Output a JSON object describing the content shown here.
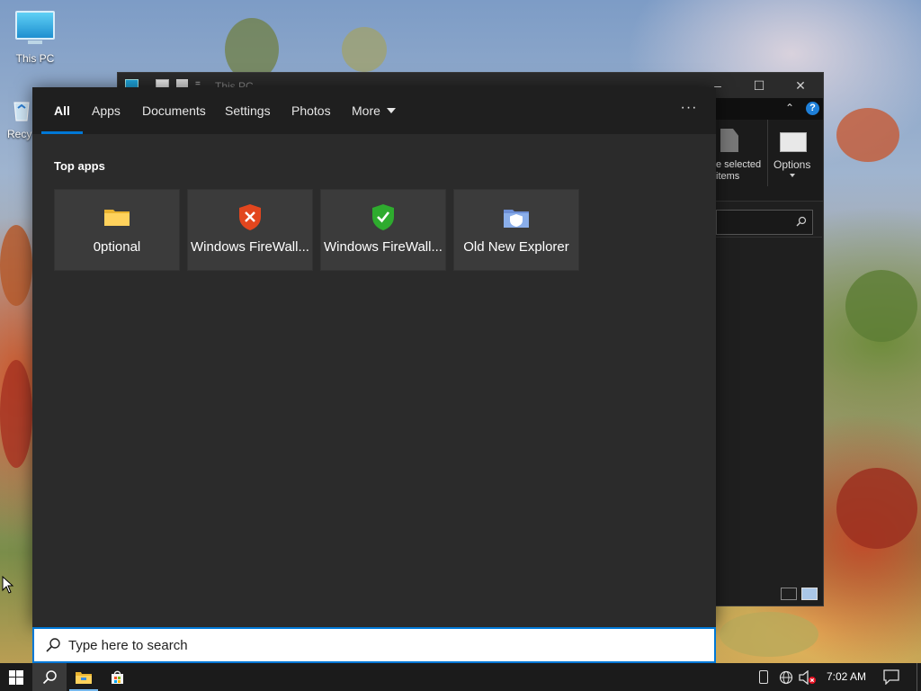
{
  "desktop": {
    "icons": [
      {
        "label": "This PC"
      },
      {
        "label": "Recy"
      }
    ]
  },
  "explorer": {
    "title": "This PC",
    "ribbon_select_label": "e selected\nitems",
    "ribbon_options_label": "Options"
  },
  "search_panel": {
    "tabs": [
      {
        "label": "All",
        "active": true
      },
      {
        "label": "Apps"
      },
      {
        "label": "Documents"
      },
      {
        "label": "Settings"
      },
      {
        "label": "Photos"
      },
      {
        "label": "More"
      }
    ],
    "more_options_glyph": "···",
    "section_title": "Top apps",
    "top_apps": [
      {
        "label": "0ptional",
        "icon": "folder-icon"
      },
      {
        "label": "Windows FireWall...",
        "icon": "shield-x-icon"
      },
      {
        "label": "Windows FireWall...",
        "icon": "shield-check-icon"
      },
      {
        "label": "Old New Explorer",
        "icon": "shield-folder-icon"
      }
    ]
  },
  "search_box": {
    "placeholder": "Type here to search",
    "value": ""
  },
  "taskbar": {
    "clock": "7:02 AM"
  },
  "colors": {
    "accent": "#0078d7",
    "panel_bg": "#2b2b2b",
    "tabs_bg": "#1f1f1f",
    "tile_bg": "#3b3b3b",
    "taskbar_bg": "#1b1b1b"
  }
}
